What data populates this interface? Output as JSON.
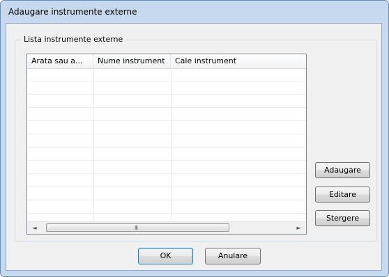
{
  "window": {
    "title": "Adaugare instrumente externe"
  },
  "group": {
    "label": "Lista instrumente externe"
  },
  "list": {
    "columns": [
      "Arata sau a...",
      "Nume instrument",
      "Cale instrument"
    ],
    "rows": []
  },
  "scrollbar": {
    "left_arrow": "◄",
    "right_arrow": "►",
    "grip": "III"
  },
  "side_buttons": {
    "add": "Adaugare",
    "edit": "Editare",
    "delete": "Stergere"
  },
  "footer": {
    "ok": "OK",
    "cancel": "Anulare"
  }
}
